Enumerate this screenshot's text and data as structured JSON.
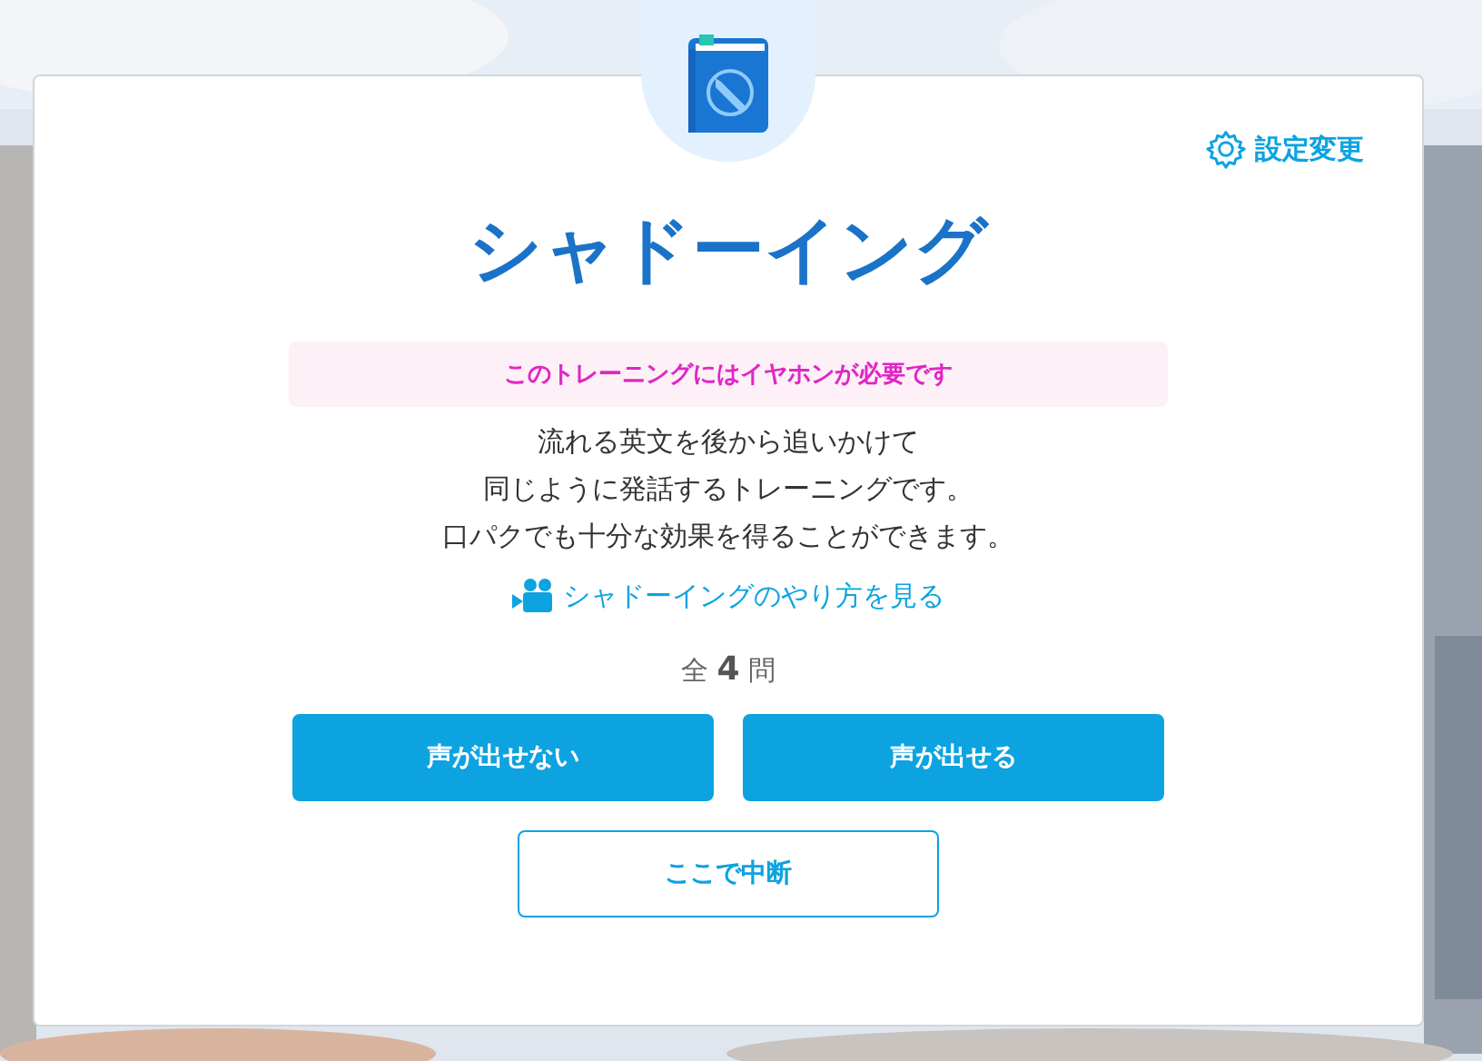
{
  "settings_link": {
    "label": "設定変更"
  },
  "title": "シャドーイング",
  "notice": "このトレーニングにはイヤホンが必要です",
  "description": [
    "流れる英文を後から追いかけて",
    "同じように発話するトレーニングです。",
    "口パクでも十分な効果を得ることができます。"
  ],
  "video_link": {
    "label": "シャドーイングのやり方を見る"
  },
  "question_count": "全 **4** 問",
  "buttons": [
    {
      "label": "声が出せない",
      "kind": "primary"
    },
    {
      "label": "声が出せる",
      "kind": "primary"
    },
    {
      "label": "ここで中断",
      "kind": "outline"
    }
  ]
}
